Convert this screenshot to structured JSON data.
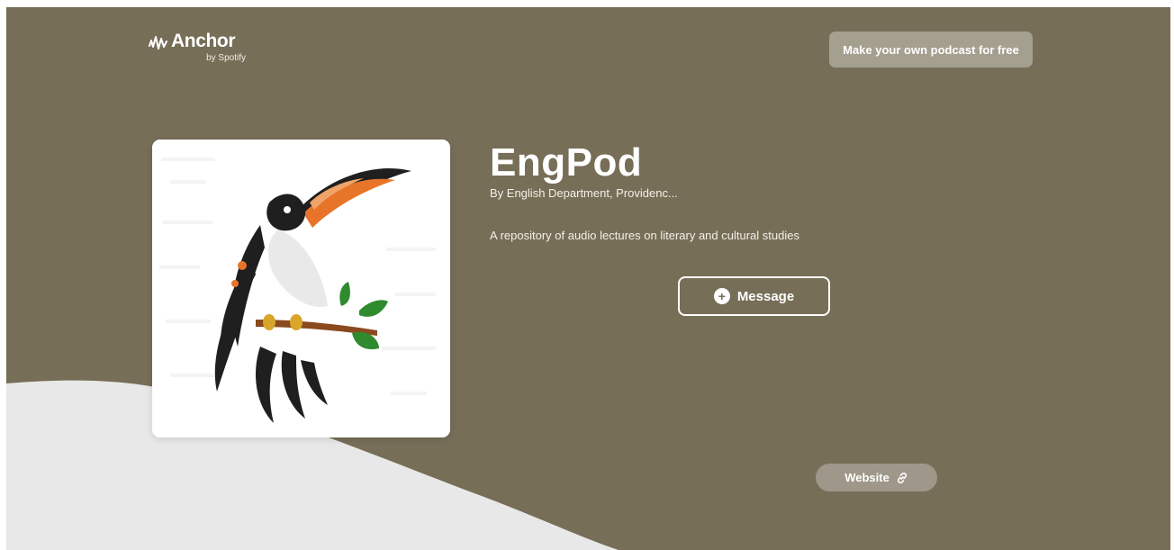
{
  "brand": {
    "name": "Anchor",
    "tagline": "by Spotify",
    "logo_icon": "anchor-waveform-icon"
  },
  "header": {
    "cta_label": "Make your own podcast for free"
  },
  "podcast": {
    "title": "EngPod",
    "author": "By English Department, Providenc...",
    "description": "A repository of audio lectures on literary and cultural studies",
    "cover_image": "toucan-on-branch-illustration"
  },
  "actions": {
    "message_label": "Message",
    "message_icon": "plus-circle-icon",
    "website_label": "Website",
    "website_icon": "link-icon"
  },
  "colors": {
    "background": "#776e58",
    "wave": "#e8e8e8",
    "cta_button": "#a59f90",
    "website_button": "#9f988a",
    "text": "#ffffff"
  }
}
